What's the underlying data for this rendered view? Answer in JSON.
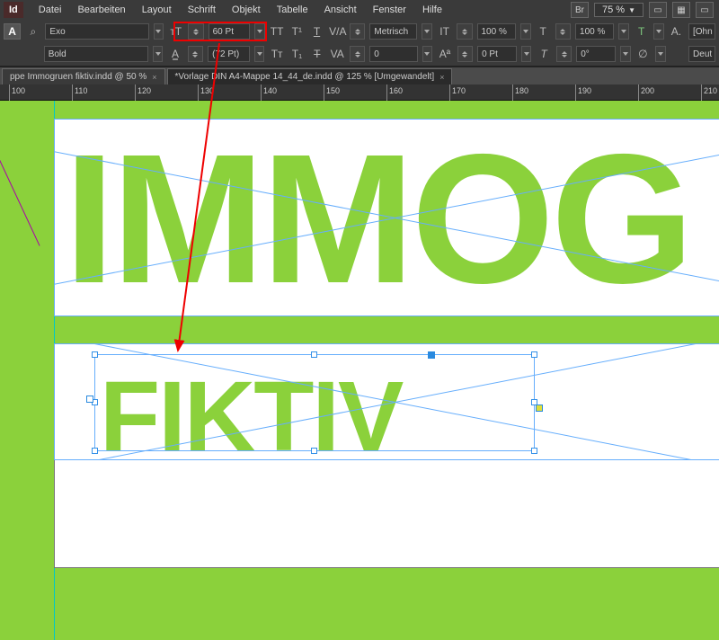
{
  "menu": [
    "Datei",
    "Bearbeiten",
    "Layout",
    "Schrift",
    "Objekt",
    "Tabelle",
    "Ansicht",
    "Fenster",
    "Hilfe"
  ],
  "topbar": {
    "br_label": "Br",
    "zoom": "75 %"
  },
  "control": {
    "font_name": "Exo",
    "font_style": "Bold",
    "font_size": "60 Pt",
    "leading": "(72 Pt)",
    "kerning": "Metrisch",
    "tracking": "0",
    "vscale": "100 %",
    "hscale": "100 %",
    "baseline": "0 Pt",
    "skew": "0°",
    "lang": "Deut",
    "ohn": "[Ohn"
  },
  "tabs": [
    {
      "label": "ppe Immogruen fiktiv.indd @ 50 %",
      "active": false
    },
    {
      "label": "*Vorlage DIN A4-Mappe 14_44_de.indd @ 125 %  [Umgewandelt]",
      "active": true
    }
  ],
  "ruler_ticks": [
    100,
    110,
    120,
    130,
    140,
    150,
    160,
    170,
    180,
    190,
    200,
    210
  ],
  "doc": {
    "headline": "IMMOG",
    "sub": "FIKTIV"
  }
}
